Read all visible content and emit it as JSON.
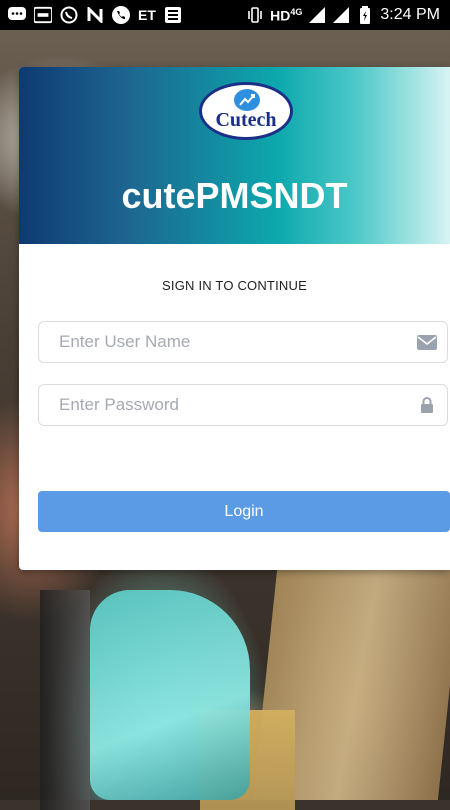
{
  "status_bar": {
    "left_icons": [
      "chat-bubble-icon",
      "paytm-icon",
      "whatsapp-icon",
      "n-icon",
      "phone-icon",
      "et-icon",
      "news-icon"
    ],
    "et_label": "ET",
    "network": "HD",
    "network_type": "4G",
    "time": "3:24 PM"
  },
  "login": {
    "logo_text": "Cutech",
    "app_title": "cutePMSNDT",
    "subtitle": "SIGN IN TO CONTINUE",
    "username_placeholder": "Enter User Name",
    "password_placeholder": "Enter Password",
    "login_label": "Login"
  },
  "colors": {
    "button": "#5b9be6",
    "header_start": "#0e3a72",
    "header_mid": "#0ca8ad",
    "header_end": "#d7f3f3"
  }
}
